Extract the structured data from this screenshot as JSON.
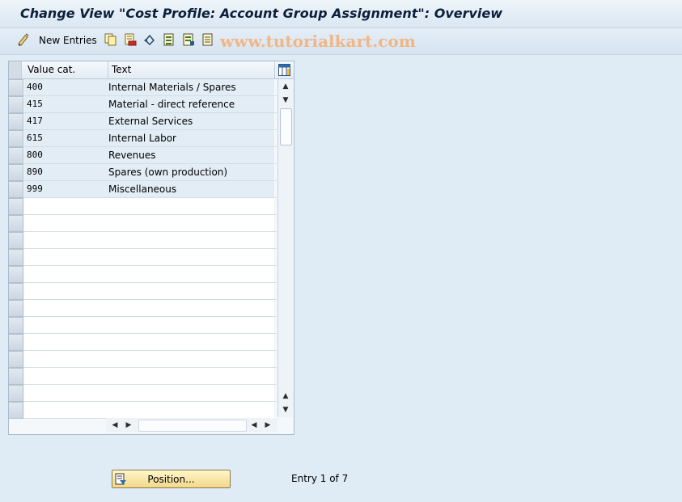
{
  "window": {
    "title": "Change View \"Cost Profile: Account Group Assignment\": Overview"
  },
  "toolbar": {
    "new_entries_label": "New Entries",
    "icons": [
      "change-display-icon",
      "copy-icon",
      "delete-icon",
      "undo-icon",
      "select-all-icon",
      "select-block-icon",
      "deselect-all-icon"
    ]
  },
  "watermark": "www.tutorialkart.com",
  "table": {
    "columns": [
      "Value cat.",
      "Text"
    ],
    "rows": [
      {
        "value_cat": "400",
        "text": "Internal Materials / Spares"
      },
      {
        "value_cat": "415",
        "text": "Material - direct reference"
      },
      {
        "value_cat": "417",
        "text": "External Services"
      },
      {
        "value_cat": "615",
        "text": "Internal Labor"
      },
      {
        "value_cat": "800",
        "text": "Revenues"
      },
      {
        "value_cat": "890",
        "text": "Spares (own production)"
      },
      {
        "value_cat": "999",
        "text": "Miscellaneous"
      }
    ]
  },
  "footer": {
    "position_label": "Position...",
    "entry_info": "Entry 1 of 7"
  },
  "colors": {
    "background": "#dfebf5",
    "row_fill": "#e3edf6",
    "button_fill": "#f2d88a"
  }
}
